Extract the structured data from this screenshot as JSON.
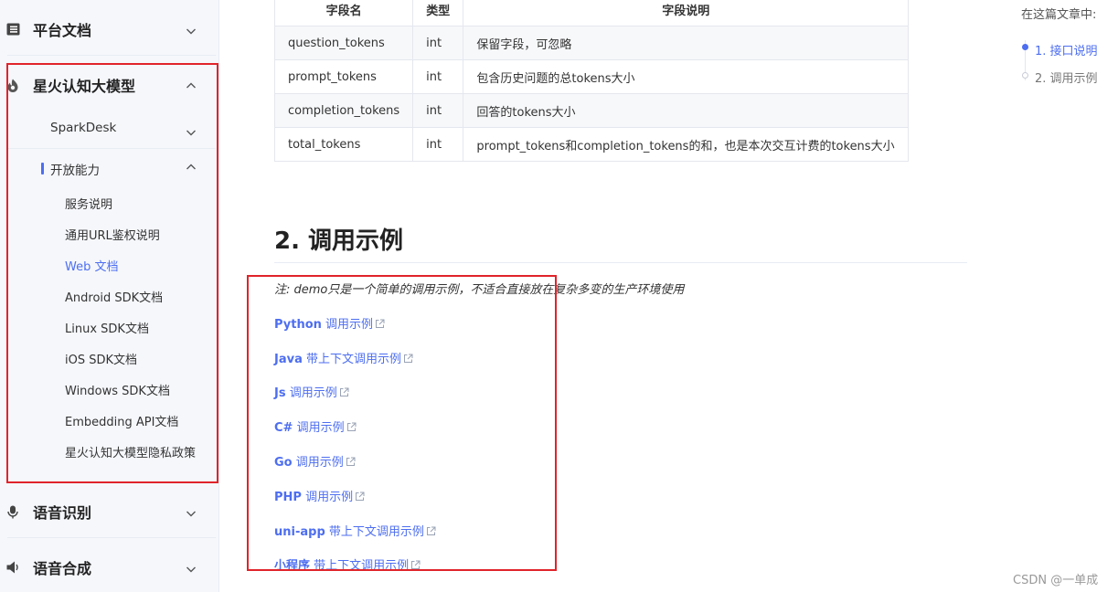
{
  "sidebar": {
    "platform_docs": "平台文档",
    "spark_model": "星火认知大模型",
    "spark_desk": "SparkDesk",
    "open_ability": "开放能力",
    "items": [
      "服务说明",
      "通用URL鉴权说明",
      "Web 文档",
      "Android SDK文档",
      "Linux SDK文档",
      "iOS SDK文档",
      "Windows SDK文档",
      "Embedding API文档",
      "星火认知大模型隐私政策"
    ],
    "speech_recognition": "语音识别",
    "speech_synthesis": "语音合成"
  },
  "table": {
    "headers": [
      "字段名",
      "类型",
      "字段说明"
    ],
    "rows": [
      [
        "question_tokens",
        "int",
        "保留字段，可忽略"
      ],
      [
        "prompt_tokens",
        "int",
        "包含历史问题的总tokens大小"
      ],
      [
        "completion_tokens",
        "int",
        "回答的tokens大小"
      ],
      [
        "total_tokens",
        "int",
        "prompt_tokens和completion_tokens的和，也是本次交互计费的tokens大小"
      ]
    ]
  },
  "section": {
    "title": "2. 调用示例",
    "note": "注: demo只是一个简单的调用示例，不适合直接放在复杂多变的生产环境使用",
    "links": [
      {
        "lang": "Python",
        "text": " 调用示例"
      },
      {
        "lang": "Java",
        "text": " 带上下文调用示例"
      },
      {
        "lang": "Js",
        "text": " 调用示例"
      },
      {
        "lang": "C#",
        "text": " 调用示例"
      },
      {
        "lang": "Go",
        "text": " 调用示例"
      },
      {
        "lang": "PHP",
        "text": " 调用示例"
      },
      {
        "lang": "uni-app",
        "text": " 带上下文调用示例"
      },
      {
        "lang": "小程序",
        "text": " 带上下文调用示例"
      }
    ]
  },
  "toc": {
    "title": "在这篇文章中:",
    "items": [
      "1. 接口说明",
      "2. 调用示例"
    ]
  },
  "watermark": "CSDN @一单成",
  "colors": {
    "accent": "#4d6ef0",
    "highlight_box": "#e0242a"
  }
}
